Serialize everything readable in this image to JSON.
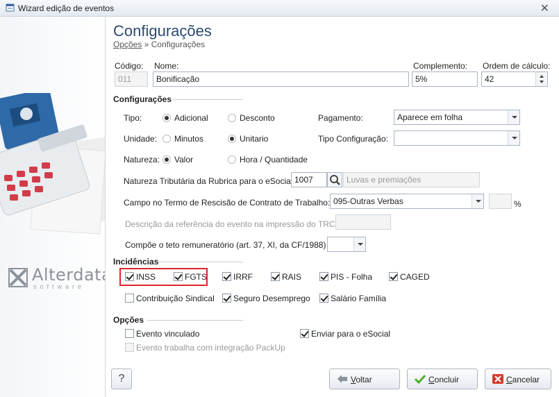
{
  "window": {
    "title": "Wizard edição de eventos"
  },
  "header": {
    "title": "Configurações",
    "crumb_link": "Opções",
    "crumb_sep": "»",
    "crumb_current": "Configurações"
  },
  "brand": {
    "name": "Alterdata",
    "sub": "software"
  },
  "top_fields": {
    "codigo_label": "Código:",
    "codigo_value": "011",
    "nome_label": "Nome:",
    "nome_value": "Bonificação",
    "complemento_label": "Complemento:",
    "complemento_value": "5%",
    "ordem_label": "Ordem de cálculo:",
    "ordem_value": "42"
  },
  "config": {
    "section": "Configurações",
    "tipo_label": "Tipo:",
    "tipo_opt1": "Adicional",
    "tipo_opt2": "Desconto",
    "unidade_label": "Unidade:",
    "unidade_opt1": "Minutos",
    "unidade_opt2": "Unitario",
    "natureza_label": "Natureza:",
    "natureza_opt1": "Valor",
    "natureza_opt2": "Hora / Quantidade",
    "pagamento_label": "Pagamento:",
    "pagamento_value": "Aparece em folha",
    "tipo_config_label": "Tipo Configuração:",
    "tipo_config_value": "",
    "natureza_trib_label": "Natureza Tributária da Rubrica para o eSocial:",
    "natureza_trib_value": "1007",
    "natureza_trib_desc": "Luvas e premiações",
    "campo_termo_label": "Campo no Termo de Rescisão de Contrato de Trabalho:",
    "campo_termo_value": "095-Outras Verbas",
    "percent_symbol": "%",
    "descricao_trct_label": "Descrição da referência do evento na impressão do TRCT",
    "compoe_teto_label": "Compõe o teto remuneratório (art. 37, XI, da CF/1988)"
  },
  "incidencias": {
    "section": "Incidências",
    "items": [
      {
        "label": "INSS",
        "checked": true
      },
      {
        "label": "FGTS",
        "checked": true
      },
      {
        "label": "IRRF",
        "checked": true
      },
      {
        "label": "RAIS",
        "checked": true
      },
      {
        "label": "PIS - Folha",
        "checked": true
      },
      {
        "label": "CAGED",
        "checked": true
      },
      {
        "label": "Contribuição Sindical",
        "checked": false
      },
      {
        "label": "Seguro Desemprego",
        "checked": true
      },
      {
        "label": "Salário Família",
        "checked": true
      }
    ]
  },
  "opcoes": {
    "section": "Opções",
    "evento_vinculado": "Evento vinculado",
    "enviar_esocial": "Enviar para o eSocial",
    "packup": "Evento trabalha com integração PackUp"
  },
  "buttons": {
    "help": "?",
    "voltar_u": "V",
    "voltar_rest": "oltar",
    "concluir_u": "C",
    "concluir_rest": "oncluir",
    "cancelar_u": "C",
    "cancelar_rest": "ancelar"
  },
  "colors": {
    "title": "#2b4a6f",
    "highlight": "#e0242c",
    "accent_green": "#4caf2a",
    "accent_red": "#d33a2c"
  }
}
